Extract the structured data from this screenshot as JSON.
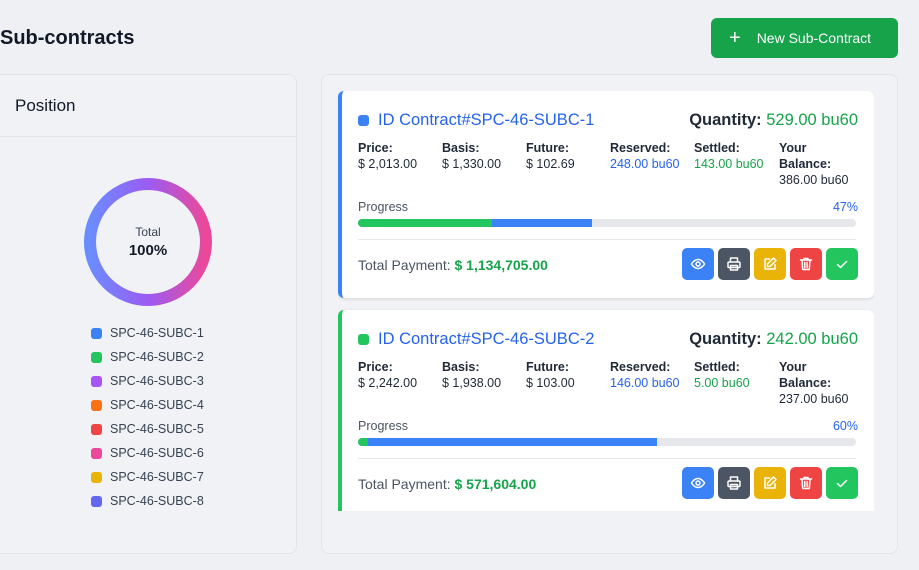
{
  "header": {
    "title": "Sub-contracts",
    "new_button_label": "New Sub-Contract",
    "new_button_icon": "plus-icon"
  },
  "position": {
    "title": "Position",
    "donut": {
      "label": "Total",
      "value": "100%"
    },
    "legend": [
      {
        "label": "SPC-46-SUBC-1",
        "color": "#3b82f6"
      },
      {
        "label": "SPC-46-SUBC-2",
        "color": "#22c55e"
      },
      {
        "label": "SPC-46-SUBC-3",
        "color": "#a855f7"
      },
      {
        "label": "SPC-46-SUBC-4",
        "color": "#f97316"
      },
      {
        "label": "SPC-46-SUBC-5",
        "color": "#ef4444"
      },
      {
        "label": "SPC-46-SUBC-6",
        "color": "#ec4899"
      },
      {
        "label": "SPC-46-SUBC-7",
        "color": "#eab308"
      },
      {
        "label": "SPC-46-SUBC-8",
        "color": "#6366f1"
      }
    ]
  },
  "contracts": [
    {
      "accent": "#3b82f6",
      "title": "ID Contract#SPC-46-SUBC-1",
      "quantity_label": "Quantity:",
      "quantity_value": "529.00 bu60",
      "fields": [
        {
          "label": "Price:",
          "value": "$ 2,013.00",
          "tone": ""
        },
        {
          "label": "Basis:",
          "value": "$ 1,330.00",
          "tone": ""
        },
        {
          "label": "Future:",
          "value": "$ 102.69",
          "tone": ""
        },
        {
          "label": "Reserved:",
          "value": "248.00 bu60",
          "tone": "blue"
        },
        {
          "label": "Settled:",
          "value": "143.00 bu60",
          "tone": "green"
        },
        {
          "label": "Your Balance:",
          "value": "386.00 bu60",
          "tone": ""
        }
      ],
      "progress_label": "Progress",
      "progress_pct": "47%",
      "progress_settled_fraction": 0.27,
      "progress_reserved_fraction": 0.47,
      "total_label": "Total Payment:",
      "total_value": "$ 1,134,705.00"
    },
    {
      "accent": "#22c55e",
      "title": "ID Contract#SPC-46-SUBC-2",
      "quantity_label": "Quantity:",
      "quantity_value": "242.00 bu60",
      "fields": [
        {
          "label": "Price:",
          "value": "$ 2,242.00",
          "tone": ""
        },
        {
          "label": "Basis:",
          "value": "$ 1,938.00",
          "tone": ""
        },
        {
          "label": "Future:",
          "value": "$ 103.00",
          "tone": ""
        },
        {
          "label": "Reserved:",
          "value": "146.00 bu60",
          "tone": "blue"
        },
        {
          "label": "Settled:",
          "value": "5.00 bu60",
          "tone": "green"
        },
        {
          "label": "Your Balance:",
          "value": "237.00 bu60",
          "tone": ""
        }
      ],
      "progress_label": "Progress",
      "progress_pct": "60%",
      "progress_settled_fraction": 0.02,
      "progress_reserved_fraction": 0.6,
      "total_label": "Total Payment:",
      "total_value": "$ 571,604.00"
    }
  ],
  "actions": [
    {
      "name": "view-button",
      "icon": "eye-icon",
      "color": "#3b82f6"
    },
    {
      "name": "print-button",
      "icon": "printer-icon",
      "color": "#4b5563"
    },
    {
      "name": "edit-button",
      "icon": "edit-icon",
      "color": "#eab308"
    },
    {
      "name": "delete-button",
      "icon": "trash-icon",
      "color": "#ef4444"
    },
    {
      "name": "approve-button",
      "icon": "check-icon",
      "color": "#22c55e"
    }
  ],
  "colors": {
    "green_primary": "#16a34a",
    "blue_primary": "#2563eb",
    "track": "#e5e7eb"
  }
}
